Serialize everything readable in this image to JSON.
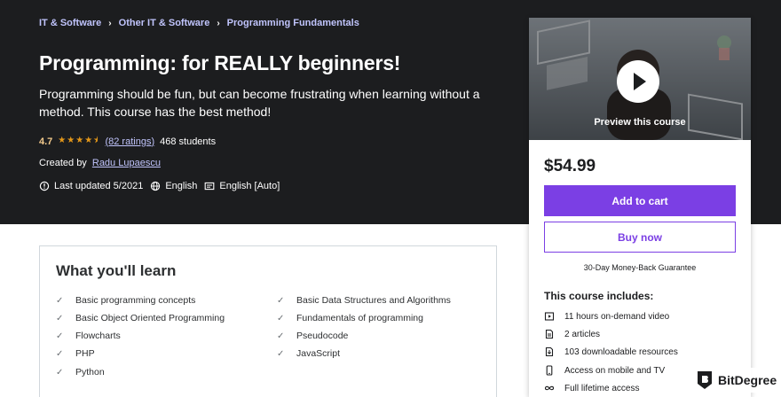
{
  "breadcrumb": [
    {
      "label": "IT & Software"
    },
    {
      "label": "Other IT & Software"
    },
    {
      "label": "Programming Fundamentals"
    }
  ],
  "breadcrumb_separator": "›",
  "course": {
    "title": "Programming: for REALLY beginners!",
    "subtitle": "Programming should be fun, but can become frustrating when learning without a method. This course has the best method!",
    "rating": "4.7",
    "stars": "★★★★⯨",
    "ratings_count": "(82 ratings)",
    "students": "468 students",
    "created_by_label": "Created by",
    "author": "Radu Lupaescu",
    "last_updated": "Last updated 5/2021",
    "language": "English",
    "captions": "English [Auto]"
  },
  "learn": {
    "title": "What you'll learn",
    "check": "✓",
    "left": [
      "Basic programming concepts",
      "Basic Object Oriented Programming",
      "Flowcharts",
      "PHP",
      "Python"
    ],
    "right": [
      "Basic Data Structures and Algorithms",
      "Fundamentals of programming",
      "Pseudocode",
      "JavaScript"
    ]
  },
  "card": {
    "preview_label": "Preview this course",
    "price": "$54.99",
    "add_to_cart": "Add to cart",
    "buy_now": "Buy now",
    "guarantee": "30-Day Money-Back Guarantee",
    "includes_title": "This course includes:",
    "includes": [
      {
        "icon": "video-icon",
        "label": "11 hours on-demand video"
      },
      {
        "icon": "article-icon",
        "label": "2 articles"
      },
      {
        "icon": "download-icon",
        "label": "103 downloadable resources"
      },
      {
        "icon": "mobile-icon",
        "label": "Access on mobile and TV"
      },
      {
        "icon": "infinity-icon",
        "label": "Full lifetime access"
      }
    ]
  },
  "watermark": {
    "text": "BitDegree"
  },
  "colors": {
    "hero_bg": "#1c1d1f",
    "accent_purple": "#7b3fe4",
    "link_lavender": "#c0c4fc",
    "rating_gold": "#f3ca8c",
    "star_orange": "#e59819"
  }
}
